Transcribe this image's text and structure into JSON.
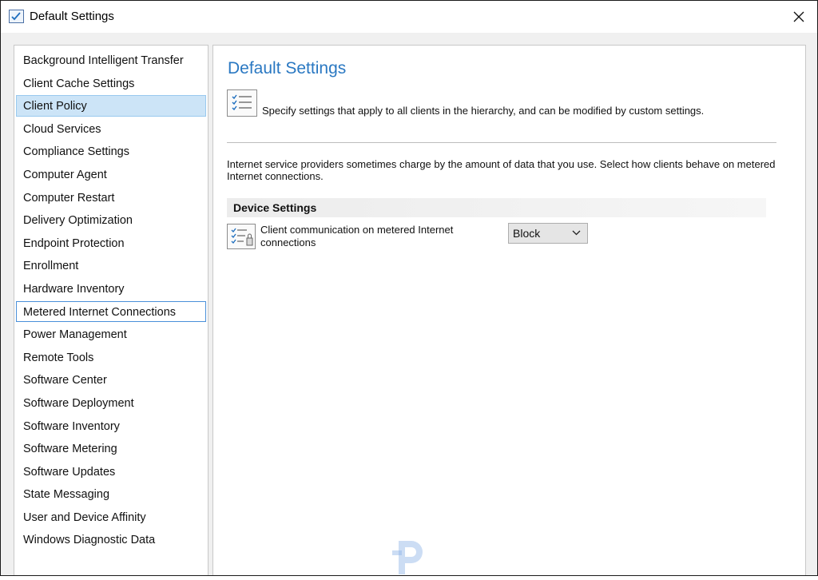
{
  "window": {
    "title": "Default Settings",
    "close_glyph": "✕"
  },
  "sidebar": {
    "items": [
      {
        "label": "Background Intelligent Transfer",
        "state": "normal"
      },
      {
        "label": "Client Cache Settings",
        "state": "normal"
      },
      {
        "label": "Client Policy",
        "state": "selected"
      },
      {
        "label": "Cloud Services",
        "state": "normal"
      },
      {
        "label": "Compliance Settings",
        "state": "normal"
      },
      {
        "label": "Computer Agent",
        "state": "normal"
      },
      {
        "label": "Computer Restart",
        "state": "normal"
      },
      {
        "label": "Delivery Optimization",
        "state": "normal"
      },
      {
        "label": "Endpoint Protection",
        "state": "normal"
      },
      {
        "label": "Enrollment",
        "state": "normal"
      },
      {
        "label": "Hardware Inventory",
        "state": "normal"
      },
      {
        "label": "Metered Internet Connections",
        "state": "focused"
      },
      {
        "label": "Power Management",
        "state": "normal"
      },
      {
        "label": "Remote Tools",
        "state": "normal"
      },
      {
        "label": "Software Center",
        "state": "normal"
      },
      {
        "label": "Software Deployment",
        "state": "normal"
      },
      {
        "label": "Software Inventory",
        "state": "normal"
      },
      {
        "label": "Software Metering",
        "state": "normal"
      },
      {
        "label": "Software Updates",
        "state": "normal"
      },
      {
        "label": "State Messaging",
        "state": "normal"
      },
      {
        "label": "User and Device Affinity",
        "state": "normal"
      },
      {
        "label": "Windows Diagnostic Data",
        "state": "normal"
      }
    ]
  },
  "content": {
    "heading": "Default Settings",
    "description": "Specify settings that apply to all clients in the hierarchy, and can be modified by custom settings.",
    "info_text": "Internet service providers sometimes charge by the amount of data that you use. Select how clients behave on metered Internet connections.",
    "section_title": "Device Settings",
    "setting": {
      "label": "Client communication on metered Internet connections",
      "value": "Block"
    }
  },
  "icons": {
    "title": "settings-checklist-icon",
    "close": "close-icon",
    "header": "checklist-icon",
    "setting": "checklist-lock-icon",
    "dropdown": "chevron-down-icon",
    "watermark": "watermark-logo"
  },
  "colors": {
    "accent_heading": "#2a78c2",
    "selected_bg": "#cce4f7",
    "selected_border": "#99c9ef",
    "focus_border": "#4a90d9"
  }
}
